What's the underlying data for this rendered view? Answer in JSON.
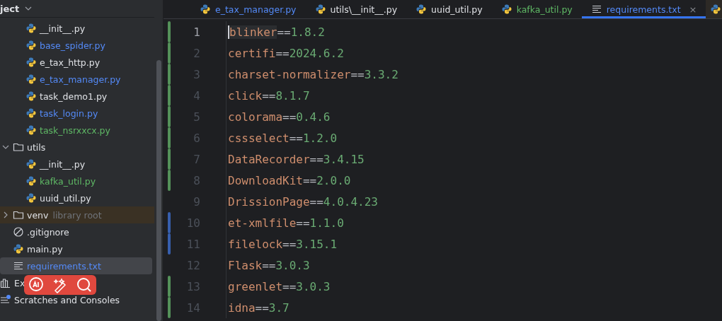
{
  "project_panel": {
    "header": "ject",
    "continued_items": [
      {
        "label": "__init__.py",
        "kind": "python",
        "color": "#dfe1e5",
        "selected": false
      },
      {
        "label": "base_spider.py",
        "kind": "python",
        "color": "#548af7",
        "selected": false
      },
      {
        "label": "e_tax_http.py",
        "kind": "python",
        "color": "#dfe1e5",
        "selected": false
      },
      {
        "label": "e_tax_manager.py",
        "kind": "python",
        "color": "#548af7",
        "selected": false
      },
      {
        "label": "task_demo1.py",
        "kind": "python",
        "color": "#dfe1e5",
        "selected": false
      },
      {
        "label": "task_login.py",
        "kind": "python",
        "color": "#548af7",
        "selected": false
      },
      {
        "label": "task_nsrxxcx.py",
        "kind": "python",
        "color": "#5fb865",
        "selected": false
      }
    ],
    "items": [
      {
        "label": "utils",
        "kind": "folder",
        "color": "#dfe1e5",
        "selected": false,
        "expanded": true,
        "children": [
          {
            "label": "__init__.py",
            "kind": "python",
            "color": "#dfe1e5",
            "selected": false
          },
          {
            "label": "kafka_util.py",
            "kind": "python",
            "color": "#5fb865",
            "selected": false
          },
          {
            "label": "uuid_util.py",
            "kind": "python",
            "color": "#dfe1e5",
            "selected": false
          }
        ]
      },
      {
        "label": "venv",
        "hint": "library root",
        "kind": "folder",
        "color": "#dfe1e5",
        "selected": false,
        "expanded": false,
        "excluded": true
      },
      {
        "label": ".gitignore",
        "kind": "ignore",
        "color": "#dfe1e5",
        "selected": false
      },
      {
        "label": "main.py",
        "kind": "python",
        "color": "#dfe1e5",
        "selected": false
      },
      {
        "label": "requirements.txt",
        "kind": "text",
        "color": "#548af7",
        "selected": true
      },
      {
        "label": "Ex",
        "kind": "libraries",
        "color": "#dfe1e5",
        "selected": false
      },
      {
        "label": "Scratches and Consoles",
        "kind": "scratches",
        "color": "#dfe1e5",
        "selected": false
      }
    ]
  },
  "tabs": [
    {
      "label": "e_tax_manager.py",
      "kind": "python",
      "color": "#548af7",
      "selected": false
    },
    {
      "label": "utils\\__init__.py",
      "kind": "python",
      "color": "#dfe1e5",
      "selected": false
    },
    {
      "label": "uuid_util.py",
      "kind": "python",
      "color": "#dfe1e5",
      "selected": false
    },
    {
      "label": "kafka_util.py",
      "kind": "python",
      "color": "#5fb865",
      "selected": false
    },
    {
      "label": "requirements.txt",
      "kind": "text",
      "color": "#548af7",
      "selected": true,
      "close": "×"
    }
  ],
  "editor": {
    "lines": [
      {
        "number": "1",
        "package": "blinker",
        "operator": "==",
        "version": "1.8.2",
        "color": "#549159",
        "current": true
      },
      {
        "number": "2",
        "package": "certifi",
        "operator": "==",
        "version": "2024.6.2",
        "color": "#549159",
        "current": false
      },
      {
        "number": "3",
        "package": "charset-normalizer",
        "operator": "==",
        "version": "3.3.2",
        "color": "#549159",
        "current": false
      },
      {
        "number": "4",
        "package": "click",
        "operator": "==",
        "version": "8.1.7",
        "color": "#549159",
        "current": false
      },
      {
        "number": "5",
        "package": "colorama",
        "operator": "==",
        "version": "0.4.6",
        "color": "#549159",
        "current": false
      },
      {
        "number": "6",
        "package": "cssselect",
        "operator": "==",
        "version": "1.2.0",
        "color": "#549159",
        "current": false
      },
      {
        "number": "7",
        "package": "DataRecorder",
        "operator": "==",
        "version": "3.4.15",
        "color": "#549159",
        "current": false
      },
      {
        "number": "8",
        "package": "DownloadKit",
        "operator": "==",
        "version": "2.0.0",
        "color": "#549159",
        "current": false
      },
      {
        "number": "9",
        "package": "DrissionPage",
        "operator": "==",
        "version": "4.0.4.23",
        "current": false
      },
      {
        "number": "10",
        "package": "et-xmlfile",
        "operator": "==",
        "version": "1.1.0",
        "color": "#375fad",
        "current": false
      },
      {
        "number": "11",
        "package": "filelock",
        "operator": "==",
        "version": "3.15.1",
        "color": "#375fad",
        "current": false
      },
      {
        "number": "12",
        "package": "Flask",
        "operator": "==",
        "version": "3.0.3",
        "current": false
      },
      {
        "number": "13",
        "package": "greenlet",
        "operator": "==",
        "version": "3.0.3",
        "color": "#549159",
        "current": false
      },
      {
        "number": "14",
        "package": "idna",
        "operator": "==",
        "version": "3.7",
        "color": "#549159",
        "current": false
      }
    ]
  },
  "floating_toolbar": {
    "buttons": [
      {
        "kind": "ai"
      },
      {
        "kind": "magic"
      },
      {
        "kind": "search"
      }
    ]
  }
}
